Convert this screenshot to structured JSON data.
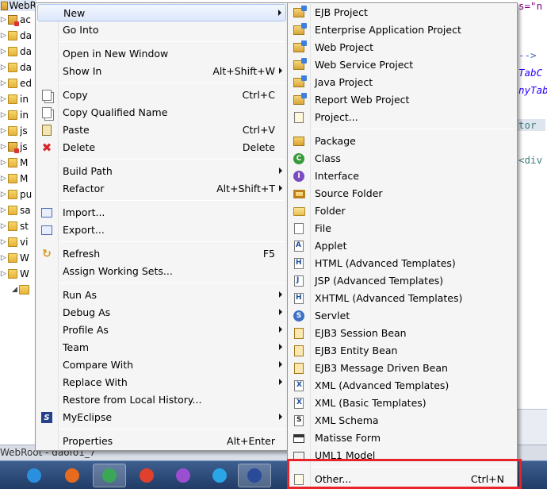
{
  "tree": {
    "header": "WebR",
    "rows": [
      {
        "label": "ac",
        "kind": "jar"
      },
      {
        "label": "da",
        "kind": "folder"
      },
      {
        "label": "da",
        "kind": "folder"
      },
      {
        "label": "da",
        "kind": "folder"
      },
      {
        "label": "ed",
        "kind": "folder"
      },
      {
        "label": "in",
        "kind": "folder"
      },
      {
        "label": "in",
        "kind": "folder"
      },
      {
        "label": "js",
        "kind": "folder"
      },
      {
        "label": "js",
        "kind": "jar"
      },
      {
        "label": "M",
        "kind": "folder"
      },
      {
        "label": "M",
        "kind": "folder"
      },
      {
        "label": "pu",
        "kind": "folder"
      },
      {
        "label": "sa",
        "kind": "folder"
      },
      {
        "label": "st",
        "kind": "folder"
      },
      {
        "label": "vi",
        "kind": "folder"
      },
      {
        "label": "W",
        "kind": "folder"
      },
      {
        "label": "W",
        "kind": "folder"
      },
      {
        "label": "",
        "kind": "folder"
      }
    ]
  },
  "editor": {
    "lines": [
      {
        "text": "s=\"n",
        "color": "#7f007f"
      },
      {
        "text": "-->",
        "color": "#3f5fbf"
      },
      {
        "text": "TabC",
        "color": "#2a00ff"
      },
      {
        "text": "nyTab",
        "color": "#2a00ff"
      },
      {
        "text": "tor",
        "color": "#3f7f7f"
      },
      {
        "text": "<div",
        "color": "#3f7f7f"
      }
    ]
  },
  "statusbar": {
    "text": "WebRoot - daofo1_7"
  },
  "context_menu": {
    "items": [
      {
        "label": "New",
        "submenu": true,
        "selected": true,
        "icon": "none"
      },
      {
        "label": "Go Into",
        "icon": "none"
      },
      {
        "sep": true
      },
      {
        "label": "Open in New Window",
        "icon": "none"
      },
      {
        "label": "Show In",
        "accel": "Alt+Shift+W",
        "submenu": true,
        "icon": "none"
      },
      {
        "sep": true
      },
      {
        "label": "Copy",
        "accel": "Ctrl+C",
        "icon": "copy-icon"
      },
      {
        "label": "Copy Qualified Name",
        "icon": "copy-qualified-icon"
      },
      {
        "label": "Paste",
        "accel": "Ctrl+V",
        "icon": "paste-icon"
      },
      {
        "label": "Delete",
        "accel": "Delete",
        "icon": "delete-icon"
      },
      {
        "sep": true
      },
      {
        "label": "Build Path",
        "submenu": true,
        "icon": "none"
      },
      {
        "label": "Refactor",
        "accel": "Alt+Shift+T",
        "submenu": true,
        "icon": "none"
      },
      {
        "sep": true
      },
      {
        "label": "Import...",
        "icon": "import-icon"
      },
      {
        "label": "Export...",
        "icon": "export-icon"
      },
      {
        "sep": true
      },
      {
        "label": "Refresh",
        "accel": "F5",
        "icon": "refresh-icon"
      },
      {
        "label": "Assign Working Sets...",
        "icon": "none"
      },
      {
        "sep": true
      },
      {
        "label": "Run As",
        "submenu": true,
        "icon": "none"
      },
      {
        "label": "Debug As",
        "submenu": true,
        "icon": "none"
      },
      {
        "label": "Profile As",
        "submenu": true,
        "icon": "none"
      },
      {
        "label": "Team",
        "submenu": true,
        "icon": "none"
      },
      {
        "label": "Compare With",
        "submenu": true,
        "icon": "none"
      },
      {
        "label": "Replace With",
        "submenu": true,
        "icon": "none"
      },
      {
        "label": "Restore from Local History...",
        "icon": "none"
      },
      {
        "label": "MyEclipse",
        "submenu": true,
        "icon": "myeclipse-icon"
      },
      {
        "sep": true
      },
      {
        "label": "Properties",
        "accel": "Alt+Enter",
        "icon": "none"
      }
    ]
  },
  "new_submenu": {
    "items": [
      {
        "label": "EJB Project",
        "icon": "ejb-project-icon"
      },
      {
        "label": "Enterprise Application Project",
        "icon": "enterprise-project-icon"
      },
      {
        "label": "Web Project",
        "icon": "web-project-icon"
      },
      {
        "label": "Web Service Project",
        "icon": "web-service-project-icon"
      },
      {
        "label": "Java Project",
        "icon": "java-project-icon"
      },
      {
        "label": "Report Web Project",
        "icon": "report-web-project-icon"
      },
      {
        "label": "Project...",
        "icon": "project-icon"
      },
      {
        "sep": true
      },
      {
        "label": "Package",
        "icon": "package-icon"
      },
      {
        "label": "Class",
        "icon": "class-icon"
      },
      {
        "label": "Interface",
        "icon": "interface-icon"
      },
      {
        "label": "Source Folder",
        "icon": "source-folder-icon"
      },
      {
        "label": "Folder",
        "icon": "folder-icon"
      },
      {
        "label": "File",
        "icon": "file-icon"
      },
      {
        "label": "Applet",
        "icon": "applet-icon"
      },
      {
        "label": "HTML (Advanced Templates)",
        "icon": "html-icon"
      },
      {
        "label": "JSP (Advanced Templates)",
        "icon": "jsp-icon"
      },
      {
        "label": "XHTML (Advanced Templates)",
        "icon": "xhtml-icon"
      },
      {
        "label": "Servlet",
        "icon": "servlet-icon"
      },
      {
        "label": "EJB3 Session Bean",
        "icon": "ejb3-session-bean-icon"
      },
      {
        "label": "EJB3 Entity Bean",
        "icon": "ejb3-entity-bean-icon"
      },
      {
        "label": "EJB3 Message Driven Bean",
        "icon": "ejb3-message-bean-icon"
      },
      {
        "label": "XML (Advanced Templates)",
        "icon": "xml-advanced-icon"
      },
      {
        "label": "XML (Basic Templates)",
        "icon": "xml-basic-icon"
      },
      {
        "label": "XML Schema",
        "icon": "xml-schema-icon"
      },
      {
        "label": "Matisse Form",
        "icon": "matisse-form-icon"
      },
      {
        "label": "UML1 Model",
        "icon": "uml-model-icon"
      },
      {
        "sep": true
      },
      {
        "label": "Other...",
        "accel": "Ctrl+N",
        "icon": "other-icon"
      }
    ]
  },
  "taskbar": {
    "apps": [
      {
        "name": "ie-icon",
        "color": "#2b8fe0",
        "active": false
      },
      {
        "name": "firefox-icon",
        "color": "#e86a1c",
        "active": false
      },
      {
        "name": "chrome-icon",
        "color": "#3aa757",
        "active": true
      },
      {
        "name": "app-red-icon",
        "color": "#e0402c",
        "active": false
      },
      {
        "name": "app-colorful-icon",
        "color": "#9a4fd0",
        "active": false
      },
      {
        "name": "app-bird-icon",
        "color": "#2aa6e8",
        "active": false
      },
      {
        "name": "myeclipse-task-icon",
        "color": "#2a4a9a",
        "active": true
      }
    ]
  },
  "highlight": {
    "color": "#e8232a",
    "target": "Other..."
  }
}
